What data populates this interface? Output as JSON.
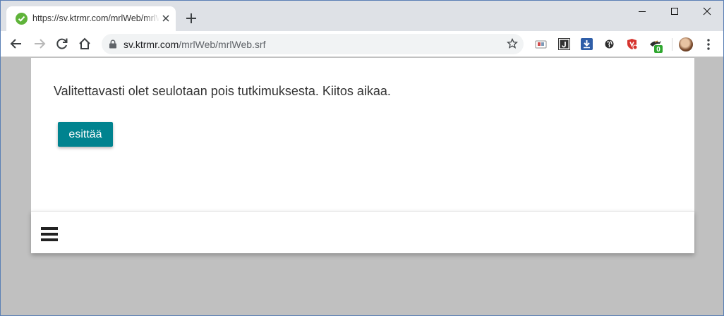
{
  "browser": {
    "tab": {
      "title": "https://sv.ktrmr.com/mrlWeb/mrlWeb.srf",
      "favicon": "check-circle-icon"
    },
    "address": {
      "host": "sv.ktrmr.com",
      "path": "/mrlWeb/mrlWeb.srf"
    },
    "extension_badge": "0"
  },
  "page": {
    "message": "Valitettavasti olet seulotaan pois tutkimuksesta. Kiitos aikaa.",
    "submit_label": "esittää",
    "menu_icon": "hamburger-menu-icon"
  },
  "colors": {
    "button": "#00838f",
    "background": "#c2c2c2",
    "favicon": "#5fb33a",
    "badge": "#2fa72f"
  }
}
